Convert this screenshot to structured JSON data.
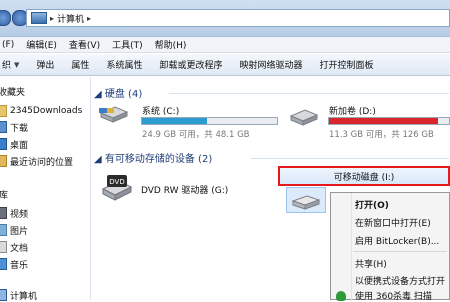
{
  "address": {
    "location": "计算机"
  },
  "menu": [
    "编辑(E)",
    "查看(V)",
    "工具(T)",
    "帮助(H)"
  ],
  "menu_partial": "(F)",
  "toolbar": {
    "items": [
      "弹出",
      "属性",
      "系统属性",
      "卸载或更改程序",
      "映射网络驱动器",
      "打开控制面板"
    ],
    "leading": "织"
  },
  "sidebar": {
    "favorites_head": "收藏夹",
    "favorites": [
      "2345Downloads",
      "下载",
      "桌面",
      "最近访问的位置"
    ],
    "libraries_head": "库",
    "libraries": [
      "视频",
      "图片",
      "文档",
      "音乐"
    ],
    "computer": "计算机"
  },
  "content": {
    "hdd_group": "硬盘 (4)",
    "removable_group": "有可移动存储的设备 (2)",
    "drives": [
      {
        "name": "系统 (C:)",
        "free": "24.9 GB 可用，共 48.1 GB",
        "used_fraction": 0.48,
        "bar_color": "#2c9bd0"
      },
      {
        "name": "新加卷 (D:)",
        "free": "11.3 GB 可用，共 126 GB",
        "used_fraction": 0.91,
        "bar_color": "#d9262c"
      }
    ],
    "dvd": "DVD RW 驱动器 (G:)",
    "dvd_badge": "DVD"
  },
  "context": {
    "header": "可移动磁盘 (I:)",
    "items": [
      "打开(O)",
      "在新窗口中打开(E)",
      "启用 BitLocker(B)...",
      "共享(H)",
      "以便携式设备方式打开",
      "使用 360杀毒 扫描"
    ]
  }
}
